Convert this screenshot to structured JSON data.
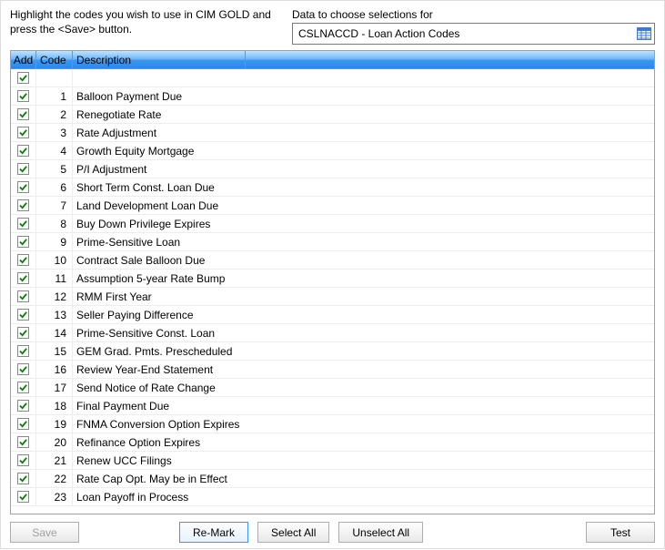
{
  "header": {
    "instruction": "Highlight the codes you wish to use in CIM GOLD and press the <Save> button.",
    "data_label": "Data to choose selections for",
    "data_value": "CSLNACCD - Loan Action Codes"
  },
  "columns": {
    "add": "Add",
    "code": "Code",
    "description": "Description"
  },
  "rows": [
    {
      "checked": true,
      "code": "",
      "desc": ""
    },
    {
      "checked": true,
      "code": "1",
      "desc": "Balloon Payment Due"
    },
    {
      "checked": true,
      "code": "2",
      "desc": "Renegotiate Rate"
    },
    {
      "checked": true,
      "code": "3",
      "desc": "Rate Adjustment"
    },
    {
      "checked": true,
      "code": "4",
      "desc": "Growth Equity Mortgage"
    },
    {
      "checked": true,
      "code": "5",
      "desc": "P/I Adjustment"
    },
    {
      "checked": true,
      "code": "6",
      "desc": "Short Term Const. Loan Due"
    },
    {
      "checked": true,
      "code": "7",
      "desc": "Land Development Loan Due"
    },
    {
      "checked": true,
      "code": "8",
      "desc": "Buy Down Privilege Expires"
    },
    {
      "checked": true,
      "code": "9",
      "desc": "Prime-Sensitive Loan"
    },
    {
      "checked": true,
      "code": "10",
      "desc": "Contract Sale Balloon Due"
    },
    {
      "checked": true,
      "code": "11",
      "desc": "Assumption 5-year Rate Bump"
    },
    {
      "checked": true,
      "code": "12",
      "desc": "RMM First Year"
    },
    {
      "checked": true,
      "code": "13",
      "desc": "Seller Paying Difference"
    },
    {
      "checked": true,
      "code": "14",
      "desc": "Prime-Sensitive Const. Loan"
    },
    {
      "checked": true,
      "code": "15",
      "desc": "GEM Grad. Pmts. Prescheduled"
    },
    {
      "checked": true,
      "code": "16",
      "desc": "Review Year-End Statement"
    },
    {
      "checked": true,
      "code": "17",
      "desc": "Send Notice of Rate Change"
    },
    {
      "checked": true,
      "code": "18",
      "desc": "Final Payment Due"
    },
    {
      "checked": true,
      "code": "19",
      "desc": "FNMA Conversion Option Expires"
    },
    {
      "checked": true,
      "code": "20",
      "desc": "Refinance Option Expires"
    },
    {
      "checked": true,
      "code": "21",
      "desc": "Renew UCC Filings"
    },
    {
      "checked": true,
      "code": "22",
      "desc": "Rate Cap Opt. May be in Effect"
    },
    {
      "checked": true,
      "code": "23",
      "desc": "Loan Payoff in Process"
    }
  ],
  "buttons": {
    "save": "Save",
    "remark": "Re-Mark",
    "select_all": "Select All",
    "unselect_all": "Unselect All",
    "test": "Test"
  }
}
